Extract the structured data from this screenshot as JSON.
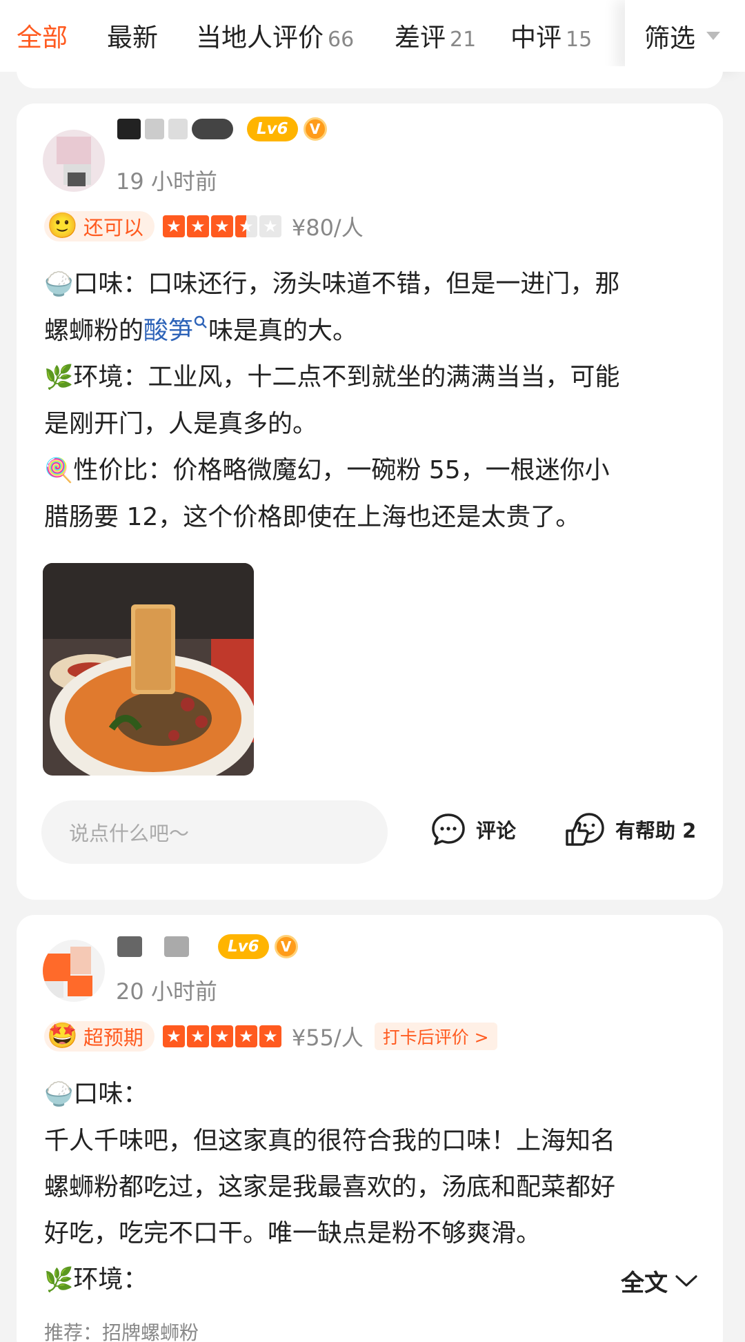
{
  "tabs": [
    {
      "label": "全部",
      "count": ""
    },
    {
      "label": "最新",
      "count": ""
    },
    {
      "label": "当地人评价",
      "count": "66"
    },
    {
      "label": "差评",
      "count": "21"
    },
    {
      "label": "中评",
      "count": "15"
    }
  ],
  "filter_label": "筛选",
  "review1": {
    "level": "Lv6",
    "vip": "V",
    "time": "19 小时前",
    "mood": "还可以",
    "price": "¥80/人",
    "lines": {
      "l1": "口味：口味还行，汤头味道不错，但是一进门，那",
      "l2a": "螺蛳粉的",
      "l2link": "酸笋",
      "l2b": "味是真的大。",
      "l3": "环境：工业风，十二点不到就坐的满满当当，可能",
      "l4": "是刚开门，人是真多的。",
      "l5": "性价比：价格略微魔幻，一碗粉 55，一根迷你小",
      "l6": "腊肠要 12，这个价格即使在上海也还是太贵了。"
    },
    "comment_placeholder": "说点什么吧～",
    "comment_label": "评论",
    "helpful_label": "有帮助 2"
  },
  "review2": {
    "level": "Lv6",
    "vip": "V",
    "time": "20 小时前",
    "mood": "超预期",
    "price": "¥55/人",
    "checkin": "打卡后评价 >",
    "lines": {
      "l1": "口味：",
      "l2": "千人千味吧，但这家真的很符合我的口味！上海知名",
      "l3": "螺蛳粉都吃过，这家是我最喜欢的，汤底和配菜都好",
      "l4": "好吃，吃完不口干。唯一缺点是粉不够爽滑。",
      "l5": "环境："
    },
    "fulltext": "全文",
    "recommend": "推荐：招牌螺蛳粉"
  },
  "colors": {
    "accent": "#ff5a1f",
    "link": "#2d63b8",
    "level_badge": "#ffb400"
  }
}
